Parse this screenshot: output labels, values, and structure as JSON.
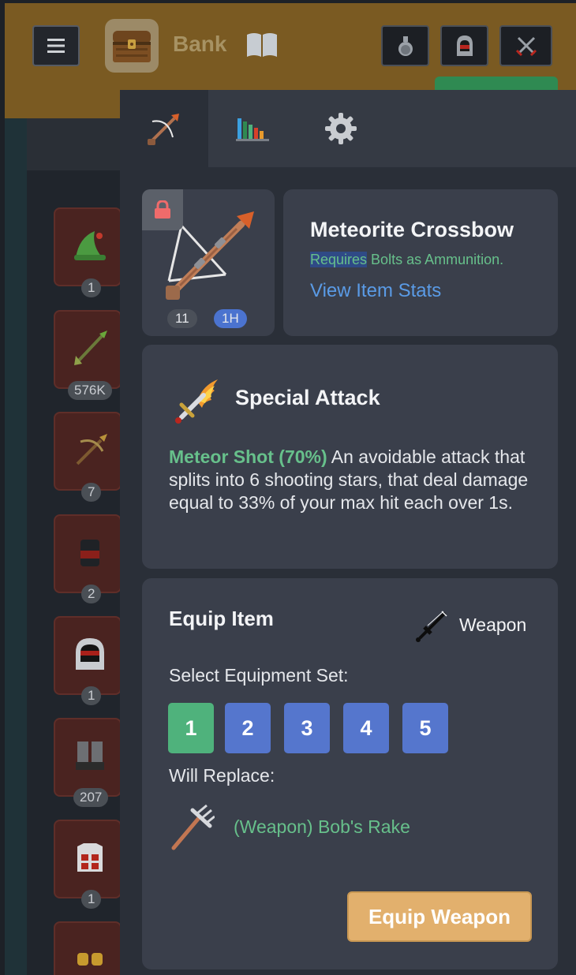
{
  "topbar": {
    "bank_label": "Bank",
    "menu_icon": "hamburger-icon",
    "actions": [
      {
        "icon": "potion-icon"
      },
      {
        "icon": "helmet-icon"
      },
      {
        "icon": "crossed-swords-icon"
      }
    ]
  },
  "bank_slots": [
    {
      "icon": "elf-hat-icon",
      "count": "1"
    },
    {
      "icon": "arrow-icon",
      "count": "576K"
    },
    {
      "icon": "crossbow-icon",
      "count": "7"
    },
    {
      "icon": "armor-icon",
      "count": "2"
    },
    {
      "icon": "hood-icon",
      "count": "1"
    },
    {
      "icon": "boots-icon",
      "count": "207"
    },
    {
      "icon": "platebody-icon",
      "count": "1"
    },
    {
      "icon": "gloves-icon",
      "count": ""
    }
  ],
  "panel": {
    "tabs": [
      {
        "icon": "crossbow-icon",
        "active": true
      },
      {
        "icon": "bar-chart-icon",
        "active": false
      },
      {
        "icon": "gear-icon",
        "active": false
      }
    ],
    "item": {
      "name": "Meteorite Crossbow",
      "requires_label": "Requires",
      "requires_text": " Bolts as Ammunition.",
      "view_stats": "View Item Stats",
      "quantity": "11",
      "hand": "1H",
      "locked": true
    },
    "special": {
      "title": "Special Attack",
      "name": "Meteor Shot (70%)",
      "description": " An avoidable attack that splits into 6 shooting stars, that deal damage equal to 33% of your max hit each over 1s."
    },
    "equip": {
      "title": "Equip Item",
      "slot": "Weapon",
      "select_label": "Select Equipment Set:",
      "sets": [
        "1",
        "2",
        "3",
        "4",
        "5"
      ],
      "selected_set": "1",
      "replace_label": "Will Replace:",
      "replace_item": "(Weapon) Bob's Rake",
      "button": "Equip Weapon"
    }
  },
  "colors": {
    "topbar": "#7a5a22",
    "panel": "#2a2f38",
    "card": "#3a3f4b",
    "accent_green": "#67c08b",
    "link_blue": "#5a9be6",
    "set_blue": "#5576cd",
    "equip_button": "#e2b06d"
  }
}
